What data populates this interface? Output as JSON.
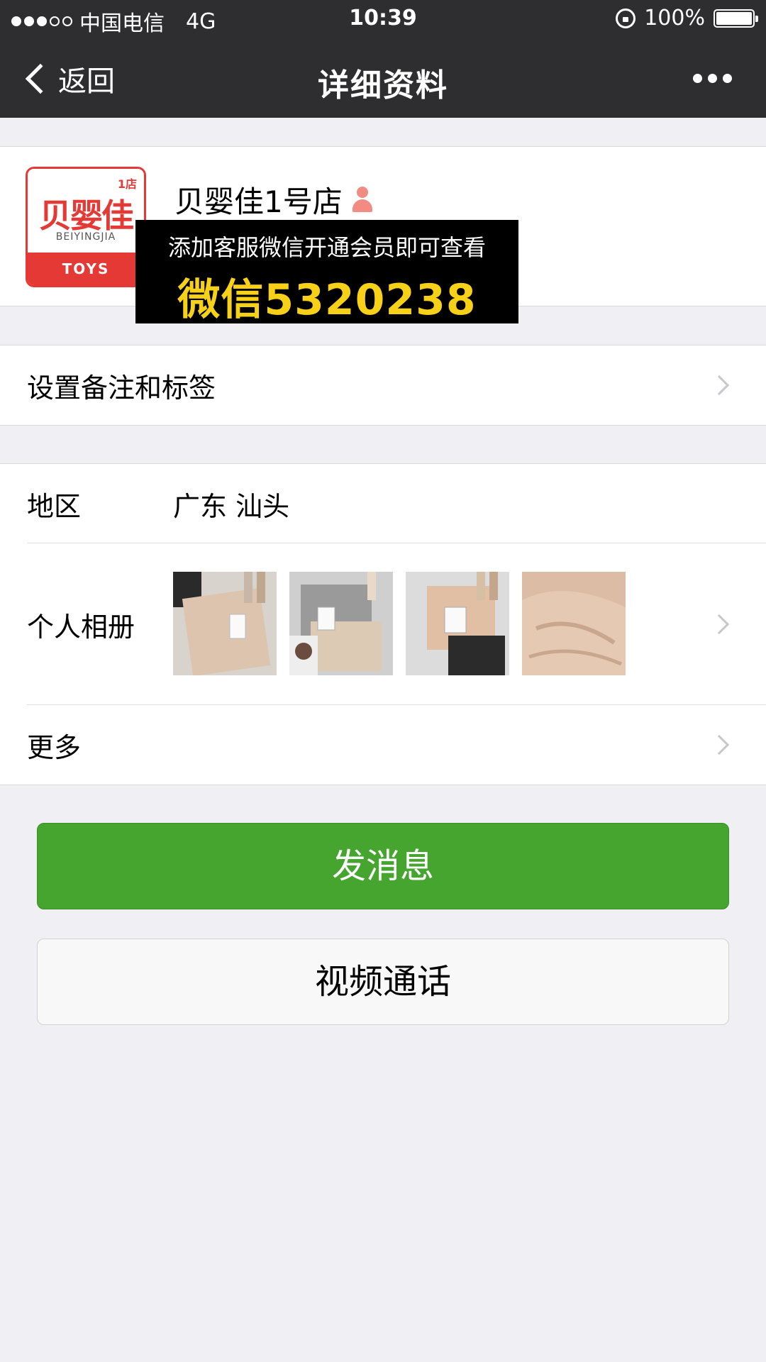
{
  "status_bar": {
    "carrier": "中国电信",
    "network": "4G",
    "time": "10:39",
    "battery": "100%"
  },
  "nav": {
    "back_label": "返回",
    "title": "详细资料"
  },
  "profile": {
    "name": "贝婴佳1号店",
    "avatar_badge": "1店",
    "avatar_logo": "贝婴佳",
    "avatar_sub": "BEIYINGJIA",
    "avatar_bottom": "TOYS",
    "gender_icon": "female-icon"
  },
  "overlay": {
    "line1": "添加客服微信开通会员即可查看",
    "line2": "微信5320238"
  },
  "rows": {
    "remark": {
      "label": "设置备注和标签"
    },
    "region": {
      "label": "地区",
      "value": "广东 汕头"
    },
    "album": {
      "label": "个人相册"
    },
    "more": {
      "label": "更多"
    }
  },
  "buttons": {
    "send_message": "发消息",
    "video_call": "视频通话"
  },
  "colors": {
    "nav_bg": "#2e2e30",
    "primary_green": "#45a52f",
    "page_bg": "#efeff4",
    "overlay_text": "#f7d117",
    "brand_red": "#e53935"
  }
}
